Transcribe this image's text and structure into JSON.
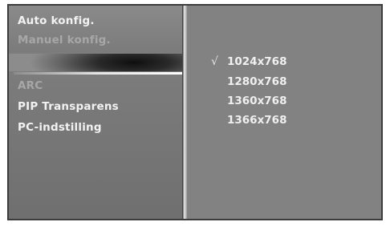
{
  "menu": {
    "items": [
      {
        "label": "Auto konfig.",
        "state": "active"
      },
      {
        "label": "Manuel konfig.",
        "state": "dim"
      },
      {
        "label": "ARC",
        "state": "dim"
      },
      {
        "label": "PIP Transparens",
        "state": "active"
      },
      {
        "label": "PC-indstilling",
        "state": "active"
      }
    ]
  },
  "options": {
    "check_mark": "√",
    "items": [
      {
        "label": "1024x768",
        "selected": true
      },
      {
        "label": "1280x768",
        "selected": false
      },
      {
        "label": "1360x768",
        "selected": false
      },
      {
        "label": "1366x768",
        "selected": false
      }
    ]
  }
}
